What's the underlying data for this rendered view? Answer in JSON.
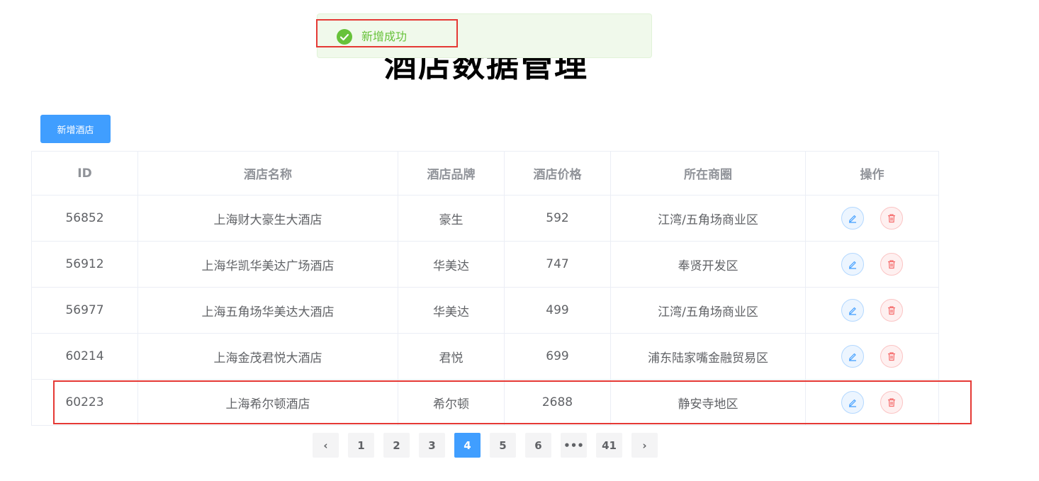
{
  "page": {
    "title": "酒店数据管理"
  },
  "toast": {
    "message": "新增成功",
    "icon": "check-circle-icon",
    "color": "#67c23a"
  },
  "toolbar": {
    "add_label": "新增酒店"
  },
  "table": {
    "headers": [
      "ID",
      "酒店名称",
      "酒店品牌",
      "酒店价格",
      "所在商圈",
      "操作"
    ],
    "rows": [
      {
        "id": "56852",
        "name": "上海财大豪生大酒店",
        "brand": "豪生",
        "price": "592",
        "area": "江湾/五角场商业区"
      },
      {
        "id": "56912",
        "name": "上海华凯华美达广场酒店",
        "brand": "华美达",
        "price": "747",
        "area": "奉贤开发区"
      },
      {
        "id": "56977",
        "name": "上海五角场华美达大酒店",
        "brand": "华美达",
        "price": "499",
        "area": "江湾/五角场商业区"
      },
      {
        "id": "60214",
        "name": "上海金茂君悦大酒店",
        "brand": "君悦",
        "price": "699",
        "area": "浦东陆家嘴金融贸易区"
      },
      {
        "id": "60223",
        "name": "上海希尔顿酒店",
        "brand": "希尔顿",
        "price": "2688",
        "area": "静安寺地区"
      }
    ],
    "row_actions": [
      "edit-icon",
      "delete-icon"
    ]
  },
  "pagination": {
    "prev": "‹",
    "next": "›",
    "pages": [
      "1",
      "2",
      "3",
      "4",
      "5",
      "6",
      "•••",
      "41"
    ],
    "current": "4"
  },
  "colors": {
    "primary": "#409eff",
    "highlight": "#e53935"
  }
}
